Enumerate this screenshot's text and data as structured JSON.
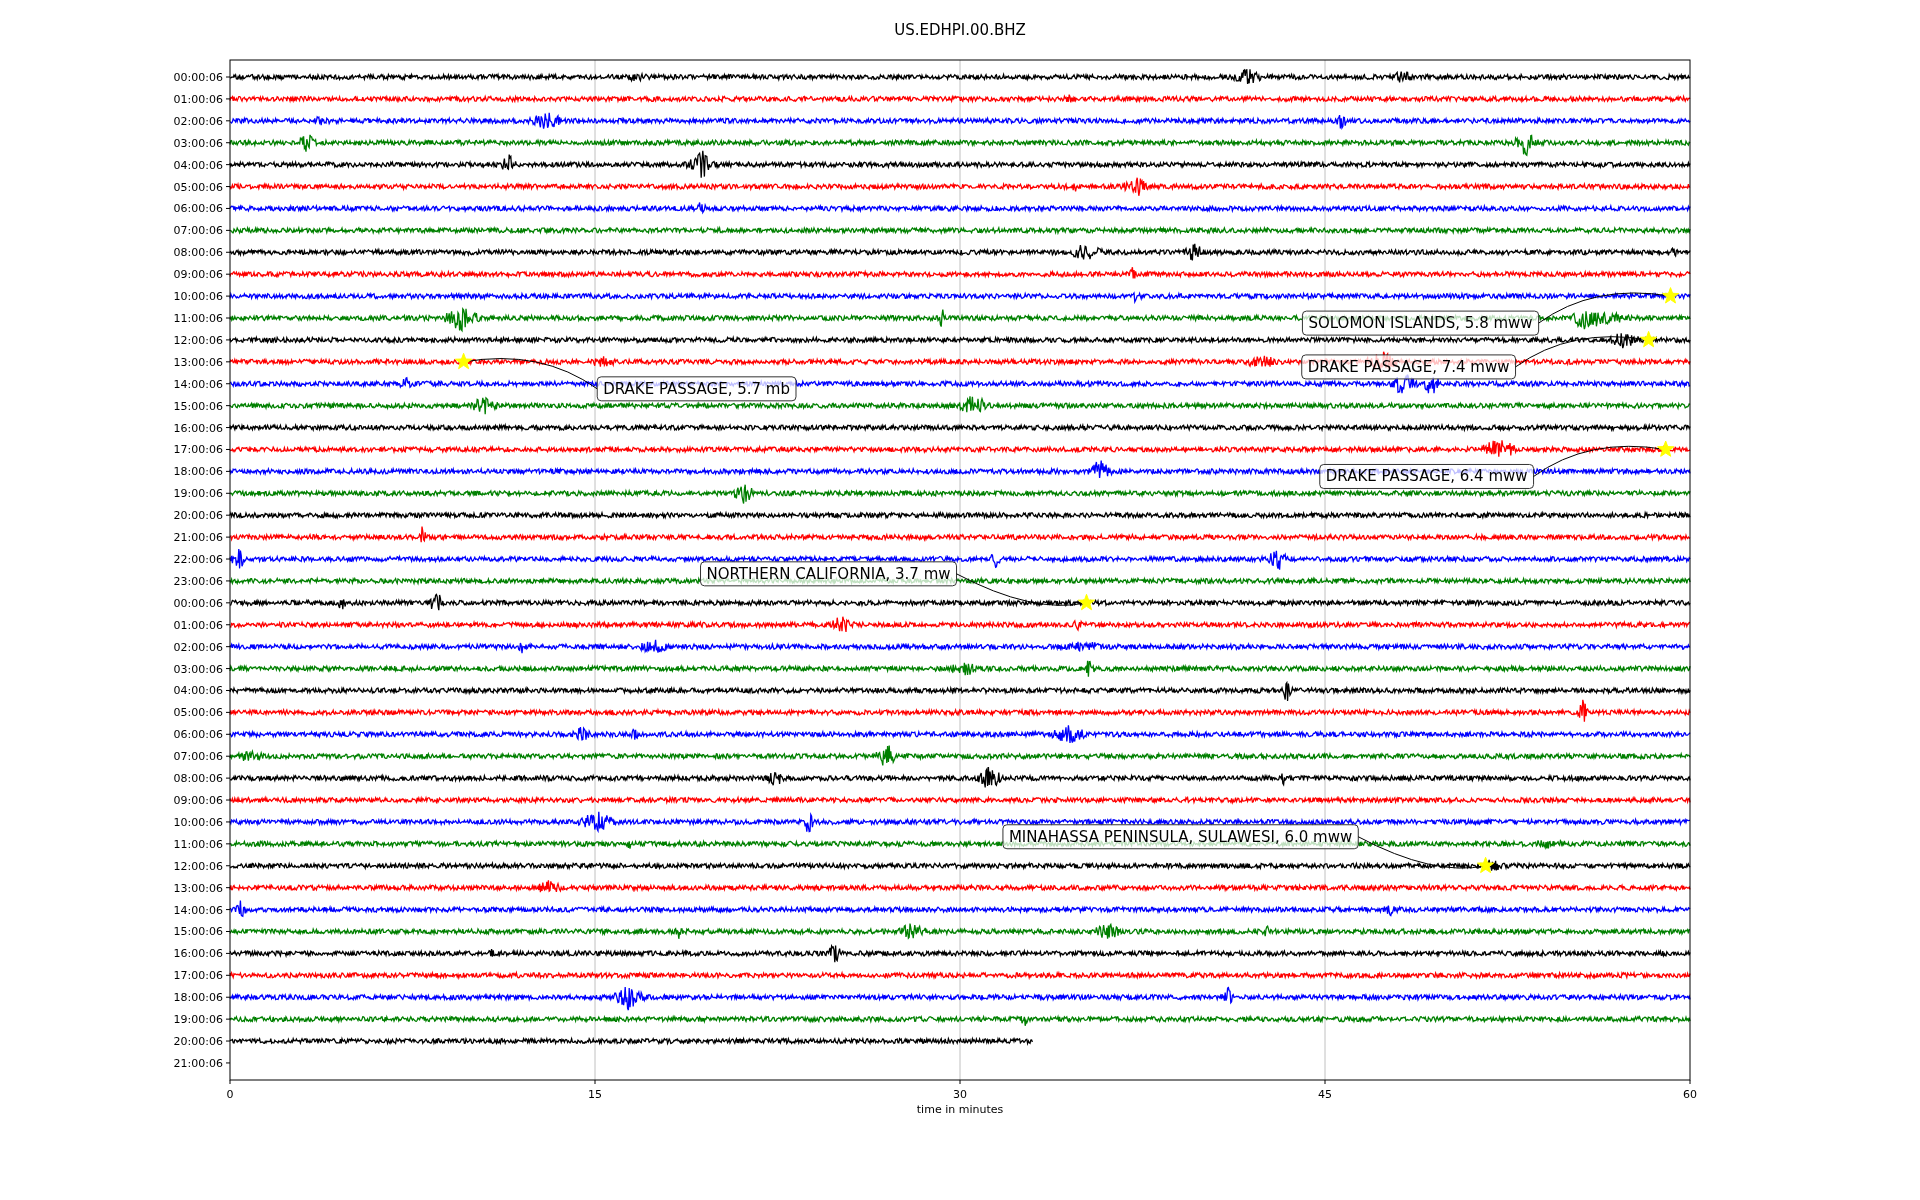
{
  "title": "US.EDHPI.00.BHZ",
  "x_axis": {
    "label": "time in minutes",
    "ticks": [
      "0",
      "15",
      "30",
      "45",
      "60"
    ]
  },
  "hour_labels": [
    "00:00:06",
    "01:00:06",
    "02:00:06",
    "03:00:06",
    "04:00:06",
    "05:00:06",
    "06:00:06",
    "07:00:06",
    "08:00:06",
    "09:00:06",
    "10:00:06",
    "11:00:06",
    "12:00:06",
    "13:00:06",
    "14:00:06",
    "15:00:06",
    "16:00:06",
    "17:00:06",
    "18:00:06",
    "19:00:06",
    "20:00:06",
    "21:00:06",
    "22:00:06",
    "23:00:06",
    "00:00:06",
    "01:00:06",
    "02:00:06",
    "03:00:06",
    "04:00:06",
    "05:00:06",
    "06:00:06",
    "07:00:06",
    "08:00:06",
    "09:00:06",
    "10:00:06",
    "11:00:06",
    "12:00:06",
    "13:00:06",
    "14:00:06",
    "15:00:06",
    "16:00:06",
    "17:00:06",
    "18:00:06",
    "19:00:06",
    "20:00:06",
    "21:00:06"
  ],
  "events": [
    {
      "text": "SOLOMON ISLANDS, 5.8 mww"
    },
    {
      "text": "DRAKE PASSAGE, 7.4 mww"
    },
    {
      "text": "DRAKE PASSAGE, 5.7 mb"
    },
    {
      "text": "DRAKE PASSAGE, 6.4 mww"
    },
    {
      "text": "NORTHERN CALIFORNIA, 3.7 mw"
    },
    {
      "text": "MINAHASSA PENINSULA, SULAWESI, 6.0 mww"
    }
  ],
  "traces": [
    {
      "color": "#000000",
      "level": 1
    },
    {
      "color": "#ff0000",
      "level": 1
    },
    {
      "color": "#0000ff",
      "level": 1
    },
    {
      "color": "#008000",
      "level": 1
    },
    {
      "color": "#000000",
      "level": 1
    },
    {
      "color": "#ff0000",
      "level": 1
    },
    {
      "color": "#0000ff",
      "level": 1
    },
    {
      "color": "#008000",
      "level": 1
    },
    {
      "color": "#000000",
      "level": 1
    },
    {
      "color": "#ff0000",
      "level": 1
    },
    {
      "color": "#0000ff",
      "level": 1
    },
    {
      "color": "#008000",
      "level": 1
    },
    {
      "color": "#000000",
      "level": 1
    },
    {
      "color": "#ff0000",
      "level": 1
    },
    {
      "color": "#0000ff",
      "level": 1
    },
    {
      "color": "#008000",
      "level": 1
    },
    {
      "color": "#000000",
      "level": 1
    },
    {
      "color": "#ff0000",
      "level": 1
    },
    {
      "color": "#0000ff",
      "level": 1
    },
    {
      "color": "#008000",
      "level": 1
    },
    {
      "color": "#000000",
      "level": 1
    },
    {
      "color": "#ff0000",
      "level": 1
    },
    {
      "color": "#0000ff",
      "level": 1
    },
    {
      "color": "#008000",
      "level": 1
    },
    {
      "color": "#000000",
      "level": 1
    },
    {
      "color": "#ff0000",
      "level": 1
    },
    {
      "color": "#0000ff",
      "level": 1
    },
    {
      "color": "#008000",
      "level": 1
    },
    {
      "color": "#000000",
      "level": 1
    },
    {
      "color": "#ff0000",
      "level": 1
    },
    {
      "color": "#0000ff",
      "level": 1
    },
    {
      "color": "#008000",
      "level": 1
    },
    {
      "color": "#000000",
      "level": 1
    },
    {
      "color": "#ff0000",
      "level": 1
    },
    {
      "color": "#0000ff",
      "level": 1
    },
    {
      "color": "#008000",
      "level": 1
    },
    {
      "color": "#000000",
      "level": 1
    },
    {
      "color": "#ff0000",
      "level": 1
    },
    {
      "color": "#0000ff",
      "level": 1
    },
    {
      "color": "#008000",
      "level": 1
    },
    {
      "color": "#000000",
      "level": 1
    },
    {
      "color": "#ff0000",
      "level": 1
    },
    {
      "color": "#0000ff",
      "level": 1
    },
    {
      "color": "#008000",
      "level": 1
    },
    {
      "color": "#000000",
      "level": 0.55
    }
  ]
}
